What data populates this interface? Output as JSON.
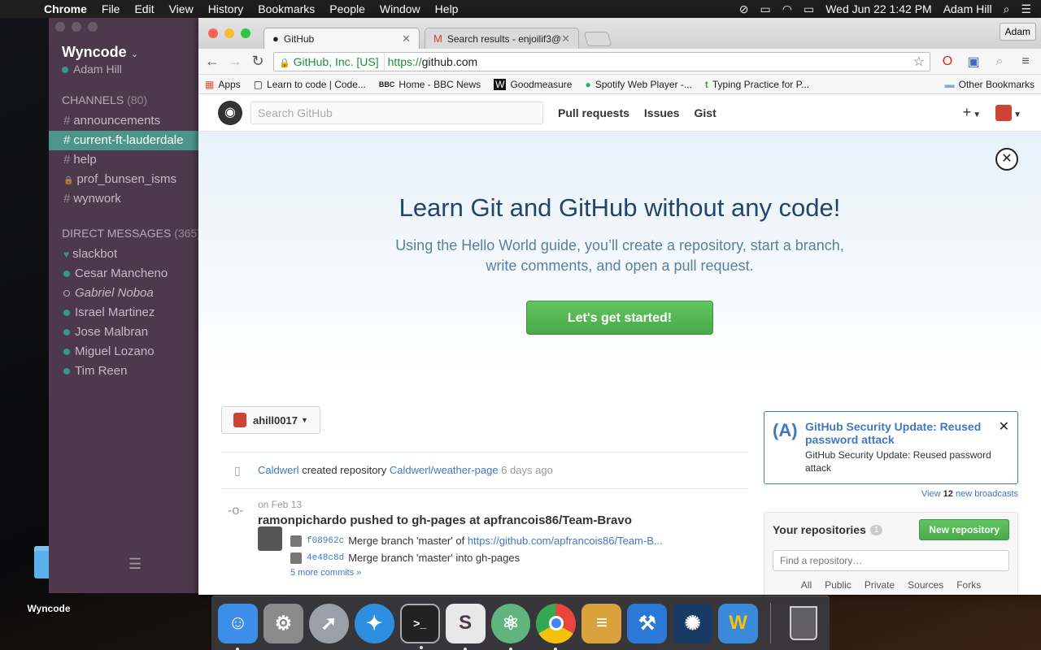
{
  "menubar": {
    "app_name": "Chrome",
    "menus": [
      "File",
      "Edit",
      "View",
      "History",
      "Bookmarks",
      "People",
      "Window",
      "Help"
    ],
    "clock": "Wed Jun 22  1:42 PM",
    "user": "Adam Hill"
  },
  "desktop": {
    "folder_label": "Wyncode"
  },
  "slack": {
    "team_name": "Wyncode",
    "current_user": "Adam Hill",
    "channels_header": "CHANNELS",
    "channels_count": "(80)",
    "channels": [
      {
        "name": "announcements",
        "prefix": "#"
      },
      {
        "name": "current-ft-lauderdale",
        "prefix": "#"
      },
      {
        "name": "help",
        "prefix": "#"
      },
      {
        "name": "prof_bunsen_isms",
        "prefix": "🔒"
      },
      {
        "name": "wynwork",
        "prefix": "#"
      }
    ],
    "dm_header": "DIRECT MESSAGES",
    "dm_count": "(365)",
    "dms": [
      "slackbot",
      "Cesar Mancheno",
      "Gabriel Noboa",
      "Israel Martinez",
      "Jose Malbran",
      "Miguel Lozano",
      "Tim Reen"
    ]
  },
  "browser": {
    "tabs": [
      {
        "title": "GitHub",
        "icon": "github-icon"
      },
      {
        "title": "Search results - enjoilif3@...",
        "icon": "gmail-icon"
      }
    ],
    "profile": "Adam",
    "ev_label": "GitHub, Inc. [US]",
    "url_scheme": "https://",
    "url_host": "github.com",
    "bookmarks": [
      {
        "label": "Apps",
        "icon": "apps-grid-icon"
      },
      {
        "label": "Learn to code | Code...",
        "icon": "codecademy-icon"
      },
      {
        "label": "Home - BBC News",
        "icon": "bbc-icon"
      },
      {
        "label": "Goodmeasure",
        "icon": "goodmeasure-icon"
      },
      {
        "label": "Spotify Web Player -...",
        "icon": "spotify-icon"
      },
      {
        "label": "Typing Practice for P...",
        "icon": "typing-icon"
      }
    ],
    "other_bookmarks": "Other Bookmarks"
  },
  "github": {
    "search_placeholder": "Search GitHub",
    "nav": [
      "Pull requests",
      "Issues",
      "Gist"
    ],
    "hero": {
      "title": "Learn Git and GitHub without any code!",
      "line1": "Using the Hello World guide, you’ll create a repository, start a branch,",
      "line2": "write comments, and open a pull request.",
      "cta": "Let's get started!"
    },
    "context_user": "ahill0017",
    "feed": {
      "item1": {
        "actor": "Caldwerl",
        "action": "created repository",
        "repo": "Caldwerl/weather-page",
        "time": "6 days ago"
      },
      "item2": {
        "date": "on Feb 13",
        "actor": "ramonpichardo",
        "action": "pushed to",
        "branch": "gh-pages",
        "at": "at",
        "repo": "apfrancois86/Team-Bravo",
        "commits": [
          {
            "sha": "f08962c",
            "message": "Merge branch 'master' of",
            "link": "https://github.com/apfrancois86/Team-B..."
          },
          {
            "sha": "4e48c8d",
            "message": "Merge branch 'master' into gh-pages",
            "link": ""
          }
        ],
        "more": "5 more commits »"
      }
    },
    "broadcast": {
      "title": "GitHub Security Update: Reused password attack",
      "body": "GitHub Security Update: Reused password attack",
      "view_pre": "View",
      "view_count": "12",
      "view_post": "new broadcasts"
    },
    "repos": {
      "title": "Your repositories",
      "count": "1",
      "new_button": "New repository",
      "filter_placeholder": "Find a repository…",
      "tabs": [
        "All",
        "Public",
        "Private",
        "Sources",
        "Forks"
      ]
    }
  },
  "dock": {
    "apps": [
      {
        "name": "Finder",
        "icon": "finder-icon",
        "color": "#3d8ee8"
      },
      {
        "name": "System Preferences",
        "icon": "gear-icon",
        "color": "#8a8a8a"
      },
      {
        "name": "Launchpad",
        "icon": "rocket-icon",
        "color": "#9aa0a8"
      },
      {
        "name": "Safari",
        "icon": "compass-icon",
        "color": "#2e8fe0"
      },
      {
        "name": "Terminal",
        "icon": "terminal-icon",
        "color": "#222222"
      },
      {
        "name": "Slack",
        "icon": "slack-icon",
        "color": "#e8e8e8"
      },
      {
        "name": "Atom",
        "icon": "atom-icon",
        "color": "#5fb57d"
      },
      {
        "name": "Chrome",
        "icon": "chrome-icon",
        "color": "#e8453c"
      },
      {
        "name": "Sequel Pro",
        "icon": "database-icon",
        "color": "#d9a23c"
      },
      {
        "name": "Xcode",
        "icon": "hammer-icon",
        "color": "#2a79d6"
      },
      {
        "name": "Battle.net",
        "icon": "battlenet-icon",
        "color": "#1a3a66"
      },
      {
        "name": "Wunderlist",
        "icon": "wunderlist-icon",
        "color": "#3b8ad9"
      }
    ],
    "trash": {
      "name": "Trash",
      "icon": "trash-icon"
    }
  }
}
